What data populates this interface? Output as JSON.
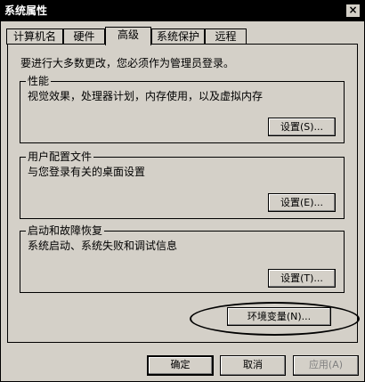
{
  "window": {
    "title": "系统属性",
    "close_label": "×"
  },
  "tabs": [
    {
      "label": "计算机名"
    },
    {
      "label": "硬件"
    },
    {
      "label": "高级"
    },
    {
      "label": "系统保护"
    },
    {
      "label": "远程"
    }
  ],
  "active_tab": "高级",
  "intro": "要进行大多数更改，您必须作为管理员登录。",
  "groups": {
    "performance": {
      "title": "性能",
      "description": "视觉效果，处理器计划，内存使用，以及虚拟内存",
      "button": "设置(S)..."
    },
    "profiles": {
      "title": "用户配置文件",
      "description": "与您登录有关的桌面设置",
      "button": "设置(E)..."
    },
    "startup": {
      "title": "启动和故障恢复",
      "description": "系统启动、系统失败和调试信息",
      "button": "设置(T)..."
    }
  },
  "env_button": "环境变量(N)...",
  "footer": {
    "ok": "确定",
    "cancel": "取消",
    "apply": "应用(A)"
  }
}
